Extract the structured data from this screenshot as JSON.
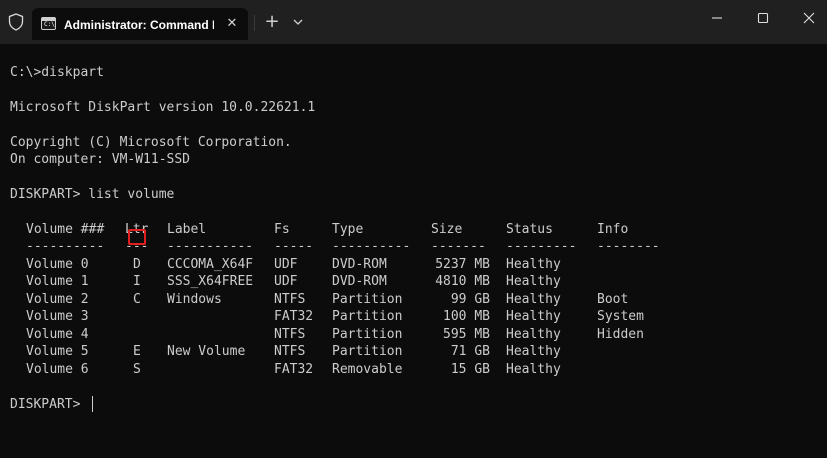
{
  "window": {
    "tab_title": "Administrator: Command Pro",
    "tab_icon_text": "C:\\",
    "close_tab": "✕",
    "new_tab": "+",
    "minimize": "—",
    "maximize": "☐",
    "close": "✕"
  },
  "console": {
    "cmd1": "C:\\>diskpart",
    "version": "Microsoft DiskPart version 10.0.22621.1",
    "copyright": "Copyright (C) Microsoft Corporation.",
    "computer": "On computer: VM-W11-SSD",
    "cmd2": "DISKPART> list volume",
    "prompt": "DISKPART> "
  },
  "table": {
    "headers": [
      "Volume ###",
      "Ltr",
      "Label",
      "Fs",
      "Type",
      "Size",
      "Status",
      "Info"
    ],
    "dashes": [
      "----------",
      "---",
      "-----------",
      "-----",
      "----------",
      "-------",
      "---------",
      "--------"
    ],
    "rows": [
      [
        "Volume 0",
        "D",
        "CCCOMA_X64F",
        "UDF",
        "DVD-ROM",
        "5237 MB",
        "Healthy",
        ""
      ],
      [
        "Volume 1",
        "I",
        "SSS_X64FREE",
        "UDF",
        "DVD-ROM",
        "4810 MB",
        "Healthy",
        ""
      ],
      [
        "Volume 2",
        "C",
        "Windows",
        "NTFS",
        "Partition",
        "99 GB",
        "Healthy",
        "Boot"
      ],
      [
        "Volume 3",
        "",
        "",
        "FAT32",
        "Partition",
        "100 MB",
        "Healthy",
        "System"
      ],
      [
        "Volume 4",
        "",
        "",
        "NTFS",
        "Partition",
        "595 MB",
        "Healthy",
        "Hidden"
      ],
      [
        "Volume 5",
        "E",
        "New Volume",
        "NTFS",
        "Partition",
        "71 GB",
        "Healthy",
        ""
      ],
      [
        "Volume 6",
        "S",
        "",
        "FAT32",
        "Removable",
        "15 GB",
        "Healthy",
        ""
      ]
    ]
  },
  "colors": {
    "background": "#0c0c0c",
    "titlebar": "#202020",
    "text": "#cccccc",
    "highlight_border": "#e0201f"
  },
  "icons": [
    "shield-icon",
    "cmd-icon",
    "close-tab-icon",
    "plus-icon",
    "chevron-down-icon",
    "minimize-icon",
    "maximize-icon",
    "close-icon"
  ]
}
